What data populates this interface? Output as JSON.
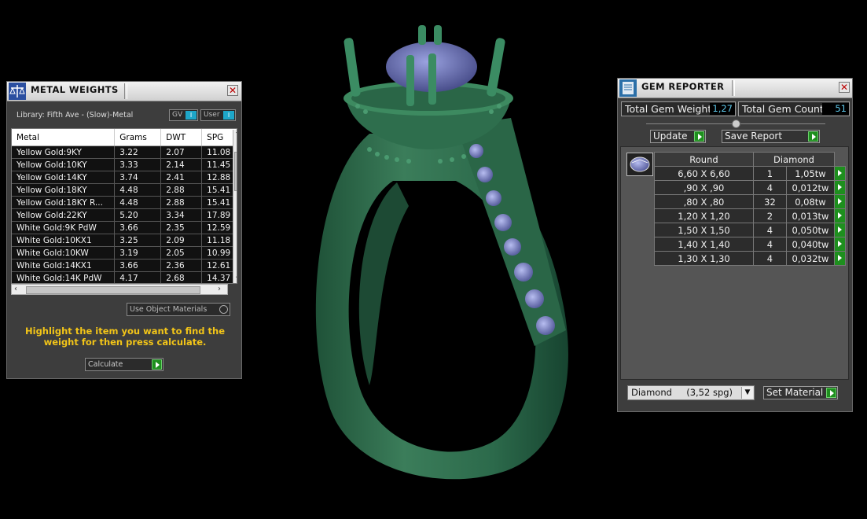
{
  "metal_weights": {
    "title": "METAL WEIGHTS",
    "library_label": "Library: Fifth Ave - (Slow)-Metal",
    "gv_label": "GV",
    "user_label": "User",
    "columns": [
      "Metal",
      "Grams",
      "DWT",
      "SPG"
    ],
    "rows": [
      [
        "Yellow Gold:9KY",
        "3.22",
        "2.07",
        "11.08"
      ],
      [
        "Yellow Gold:10KY",
        "3.33",
        "2.14",
        "11.45"
      ],
      [
        "Yellow Gold:14KY",
        "3.74",
        "2.41",
        "12.88"
      ],
      [
        "Yellow Gold:18KY",
        "4.48",
        "2.88",
        "15.41"
      ],
      [
        "Yellow Gold:18KY R...",
        "4.48",
        "2.88",
        "15.41"
      ],
      [
        "Yellow Gold:22KY",
        "5.20",
        "3.34",
        "17.89"
      ],
      [
        "White Gold:9K PdW",
        "3.66",
        "2.35",
        "12.59"
      ],
      [
        "White Gold:10KX1",
        "3.25",
        "2.09",
        "11.18"
      ],
      [
        "White Gold:10KW",
        "3.19",
        "2.05",
        "10.99"
      ],
      [
        "White Gold:14KX1",
        "3.66",
        "2.36",
        "12.61"
      ],
      [
        "White Gold:14K PdW",
        "4.17",
        "2.68",
        "14.37"
      ]
    ],
    "use_object_materials": "Use Object Materials",
    "hint": "Highlight the item you want to find the weight for then press calculate.",
    "calculate_label": "Calculate"
  },
  "gem_reporter": {
    "title": "GEM REPORTER",
    "total_weight_label": "Total Gem Weight",
    "total_weight_value": "1,27",
    "total_count_label": "Total Gem Count",
    "total_count_value": "51",
    "update_label": "Update",
    "save_report_label": "Save Report",
    "columns": [
      "Round",
      "Diamond"
    ],
    "rows": [
      [
        "6,60 X 6,60",
        "1",
        "1,05tw"
      ],
      [
        ",90 X ,90",
        "4",
        "0,012tw"
      ],
      [
        ",80 X ,80",
        "32",
        "0,08tw"
      ],
      [
        "1,20 X 1,20",
        "2",
        "0,013tw"
      ],
      [
        "1,50 X 1,50",
        "4",
        "0,050tw"
      ],
      [
        "1,40 X 1,40",
        "4",
        "0,040tw"
      ],
      [
        "1,30 X 1,30",
        "4",
        "0,032tw"
      ]
    ],
    "material_select": "Diamond     (3,52 spg)",
    "set_material_label": "Set Material"
  },
  "colors": {
    "ring_green": "#2f6f4f",
    "gem_blue": "#7a82c8",
    "hint_yellow": "#f3c518",
    "value_cyan": "#5ec8ea",
    "go_green": "#1e8f1e"
  }
}
